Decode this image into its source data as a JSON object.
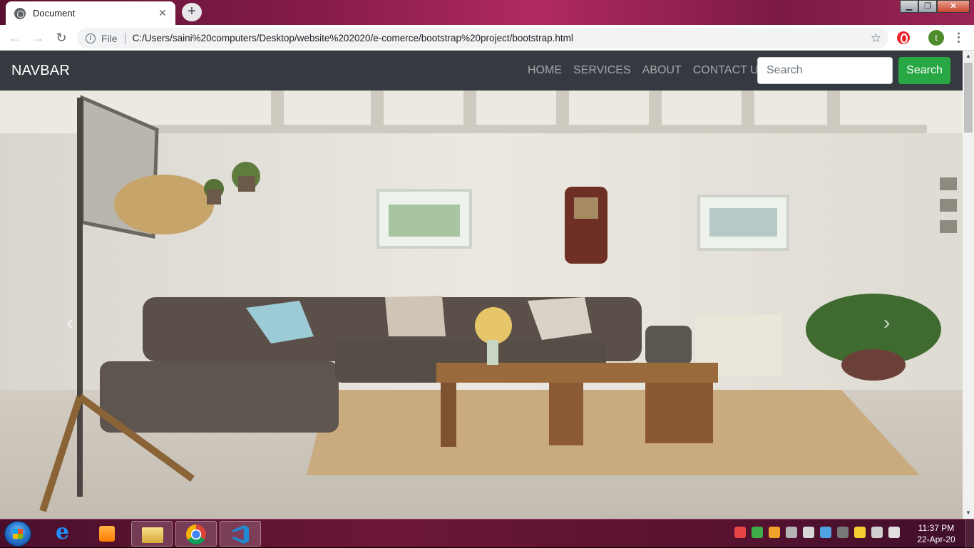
{
  "browser": {
    "tab_title": "Document",
    "tab_close": "✕",
    "new_tab": "+",
    "address_scheme": "File",
    "address_url": "C:/Users/saini%20computers/Desktop/website%202020/e-comerce/bootstrap%20project/bootstrap.html",
    "profile_initial": "t",
    "window_controls": {
      "minimize": "▁",
      "maximize": "❐",
      "close": "✕"
    }
  },
  "site": {
    "brand": "NAVBAR",
    "nav": [
      "HOME",
      "SERVICES",
      "ABOUT",
      "CONTACT US"
    ],
    "search_placeholder": "Search",
    "search_button": "Search",
    "nav_bg": "#343a40",
    "button_color": "#28a745"
  },
  "carousel": {
    "prev_icon": "‹",
    "next_icon": "›"
  },
  "taskbar": {
    "apps": [
      "start-orb",
      "internet-explorer",
      "media-player",
      "file-explorer",
      "chrome",
      "vscode"
    ],
    "time": "11:37 PM",
    "date": "22-Apr-20"
  }
}
